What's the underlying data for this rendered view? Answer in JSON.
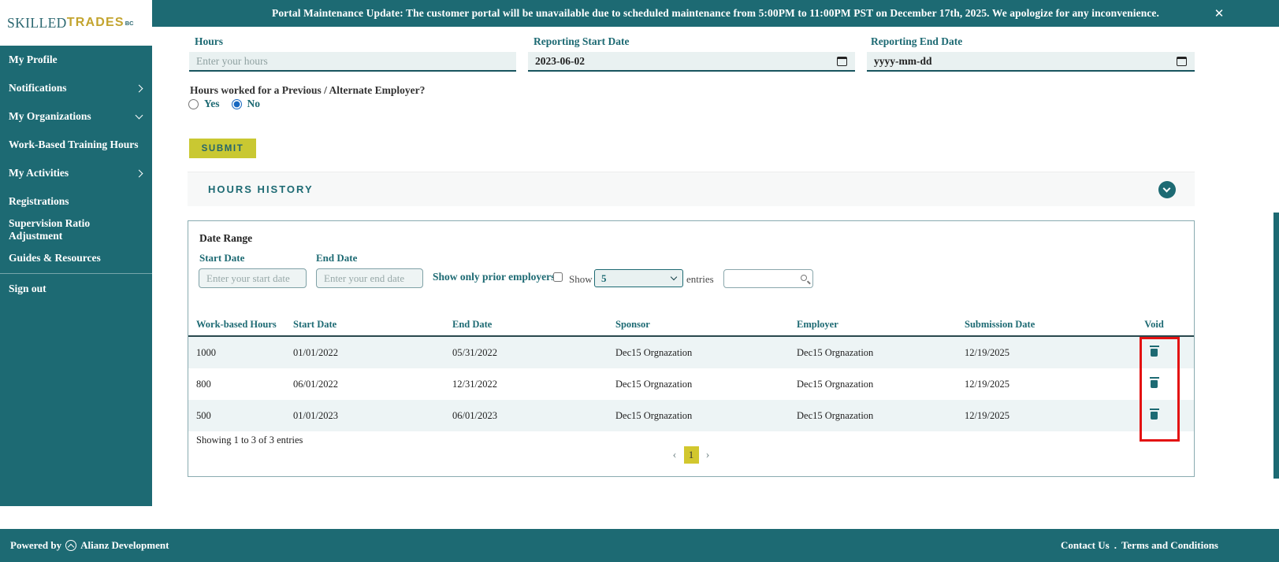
{
  "banner": {
    "text": "Portal Maintenance Update: The customer portal will be unavailable due to scheduled maintenance from 5:00PM to 11:00PM PST on December 17th, 2025. We apologize for any inconvenience."
  },
  "logo": {
    "part1": "SKILLED",
    "part2": "TRADES",
    "superscript": "BC"
  },
  "sidebar": {
    "items": [
      {
        "label": "My Profile",
        "chevron": "none"
      },
      {
        "label": "Notifications",
        "chevron": "right"
      },
      {
        "label": "My Organizations",
        "chevron": "down"
      },
      {
        "label": "Work-Based Training Hours",
        "chevron": "none"
      },
      {
        "label": "My Activities",
        "chevron": "right"
      },
      {
        "label": "Registrations",
        "chevron": "none"
      },
      {
        "label": "Supervision Ratio Adjustment",
        "chevron": "none"
      },
      {
        "label": "Guides & Resources",
        "chevron": "none"
      }
    ],
    "signout": "Sign out"
  },
  "form": {
    "hours": {
      "label": "Hours",
      "placeholder": "Enter your hours",
      "value": ""
    },
    "reporting_start": {
      "label": "Reporting Start Date",
      "value": "2023-06-02"
    },
    "reporting_end": {
      "label": "Reporting End Date",
      "placeholder": "yyyy-mm-dd"
    },
    "prev_employer_question": "Hours worked for a Previous / Alternate Employer?",
    "radio_yes": "Yes",
    "radio_no": "No",
    "radio_selected": "No",
    "submit_label": "SUBMIT"
  },
  "hours_history": {
    "title": "HOURS HISTORY",
    "filters": {
      "date_range_label": "Date Range",
      "start_date_label": "Start Date",
      "start_date_placeholder": "Enter your start date",
      "end_date_label": "End Date",
      "end_date_placeholder": "Enter your end date",
      "prior_employers_label": "Show only prior employers?",
      "show_label": "Show",
      "page_size": "5",
      "entries_label": "entries",
      "search_value": ""
    },
    "table": {
      "headers": [
        "Work-based Hours",
        "Start Date",
        "End Date",
        "Sponsor",
        "Employer",
        "Submission Date",
        "Void"
      ],
      "rows": [
        [
          "1000",
          "01/01/2022",
          "05/31/2022",
          "Dec15 Orgnazation",
          "Dec15 Orgnazation",
          "12/19/2025"
        ],
        [
          "800",
          "06/01/2022",
          "12/31/2022",
          "Dec15 Orgnazation",
          "Dec15 Orgnazation",
          "12/19/2025"
        ],
        [
          "500",
          "01/01/2023",
          "06/01/2023",
          "Dec15 Orgnazation",
          "Dec15 Orgnazation",
          "12/19/2025"
        ]
      ]
    },
    "summary": "Showing 1 to 3 of 3 entries",
    "pagination": {
      "prev": "‹",
      "page": "1",
      "next": "›"
    }
  },
  "footer": {
    "powered_by": "Powered by",
    "company": "Alianz Development",
    "contact": "Contact Us",
    "separator": ".",
    "terms": "Terms and Conditions"
  },
  "colors": {
    "teal": "#1d6a73",
    "submit_yellow": "#c9c832",
    "logo_gold": "#c3a42e",
    "row_alt": "#edf4f5",
    "annotation_red": "#e31212"
  }
}
